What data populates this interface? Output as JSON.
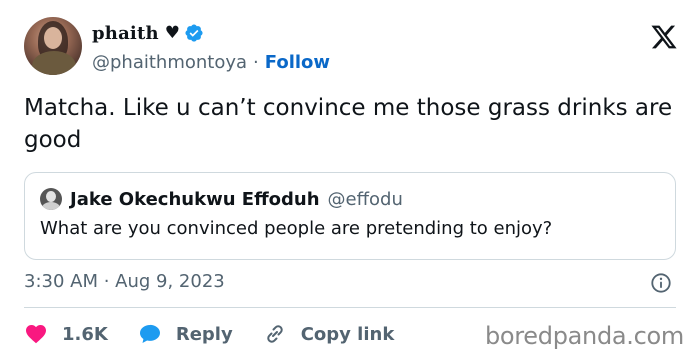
{
  "author": {
    "display_name": "phaith",
    "heart_glyph": "♥",
    "handle": "@phaithmontoya",
    "separator": "·",
    "follow_label": "Follow"
  },
  "tweet": {
    "text": "Matcha. Like u can’t convince me those grass drinks are good",
    "timestamp": "3:30 AM · Aug 9, 2023"
  },
  "quote": {
    "author_name": "Jake Okechukwu Effoduh",
    "author_handle": "@effodu",
    "text": "What are you convinced people are pretending to enjoy?"
  },
  "actions": {
    "like_count": "1.6K",
    "reply_label": "Reply",
    "copy_label": "Copy link"
  },
  "watermark": "boredpanda.com",
  "colors": {
    "accent": "#1d9bf0",
    "link": "#0a68c8",
    "like": "#f91880",
    "muted": "#536471",
    "border": "#cfd9de"
  },
  "icons": {
    "verified": "verified-badge-icon",
    "x_logo": "x-logo-icon",
    "info": "info-icon",
    "like": "heart-icon",
    "reply": "speech-bubble-icon",
    "copy": "link-icon"
  }
}
